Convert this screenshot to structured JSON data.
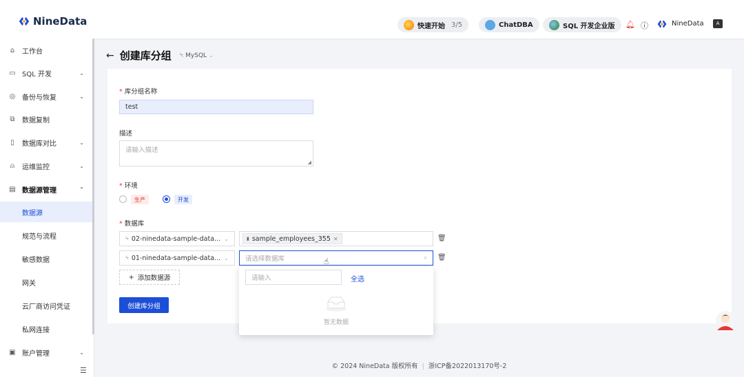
{
  "app": {
    "brand": "NineData"
  },
  "topbar": {
    "quickstart_label": "快速开始",
    "quickstart_progress": "3/5",
    "chatdba_label": "ChatDBA",
    "sql_label": "SQL 开发企业版",
    "account_label": "NineData",
    "icons": [
      "bell-icon",
      "help-icon",
      "account-logo-icon",
      "translate-icon"
    ]
  },
  "sidebar": {
    "items": [
      {
        "label": "工作台",
        "icon": "home-icon"
      },
      {
        "label": "SQL 开发",
        "icon": "monitor-icon"
      },
      {
        "label": "备份与恢复",
        "icon": "backup-icon"
      },
      {
        "label": "数据复制",
        "icon": "copy-icon"
      },
      {
        "label": "数据库对比",
        "icon": "compare-icon"
      },
      {
        "label": "运维监控",
        "icon": "alarm-icon"
      },
      {
        "label": "数据源管理",
        "icon": "datasource-icon"
      }
    ],
    "sub_items": [
      {
        "label": "数据源",
        "active": true
      },
      {
        "label": "规范与流程"
      },
      {
        "label": "敏感数据"
      },
      {
        "label": "网关"
      },
      {
        "label": "云厂商访问凭证"
      },
      {
        "label": "私网连接"
      }
    ],
    "account_item": {
      "label": "账户管理",
      "icon": "account-icon"
    }
  },
  "page": {
    "back_icon": "arrow-left-icon",
    "title": "创建库分组",
    "db_type": "MySQL"
  },
  "form": {
    "name_label": "库分组名称",
    "name_value": "test",
    "desc_label": "描述",
    "desc_placeholder": "请输入描述",
    "env_label": "环境",
    "env_options": [
      {
        "label": "生产",
        "selected": false,
        "color": "#e53935"
      },
      {
        "label": "开发",
        "selected": true,
        "color": "#1d4ed8"
      }
    ],
    "db_label": "数据库",
    "rows": [
      {
        "source": "02-ninedata-sample-data...",
        "chip": "sample_employees_355"
      },
      {
        "source": "01-ninedata-sample-data...",
        "placeholder": "请选择数据库"
      }
    ],
    "add_source_label": "添加数据源",
    "submit_label": "创建库分组"
  },
  "dropdown": {
    "search_placeholder": "请输入",
    "select_all_label": "全选",
    "empty_text": "暂无数据"
  },
  "footer": {
    "copyright": "© 2024 NineData 版权所有",
    "icp": "浙ICP备2022013170号-2"
  },
  "colors": {
    "primary": "#1d4ed8",
    "danger": "#e53935"
  }
}
